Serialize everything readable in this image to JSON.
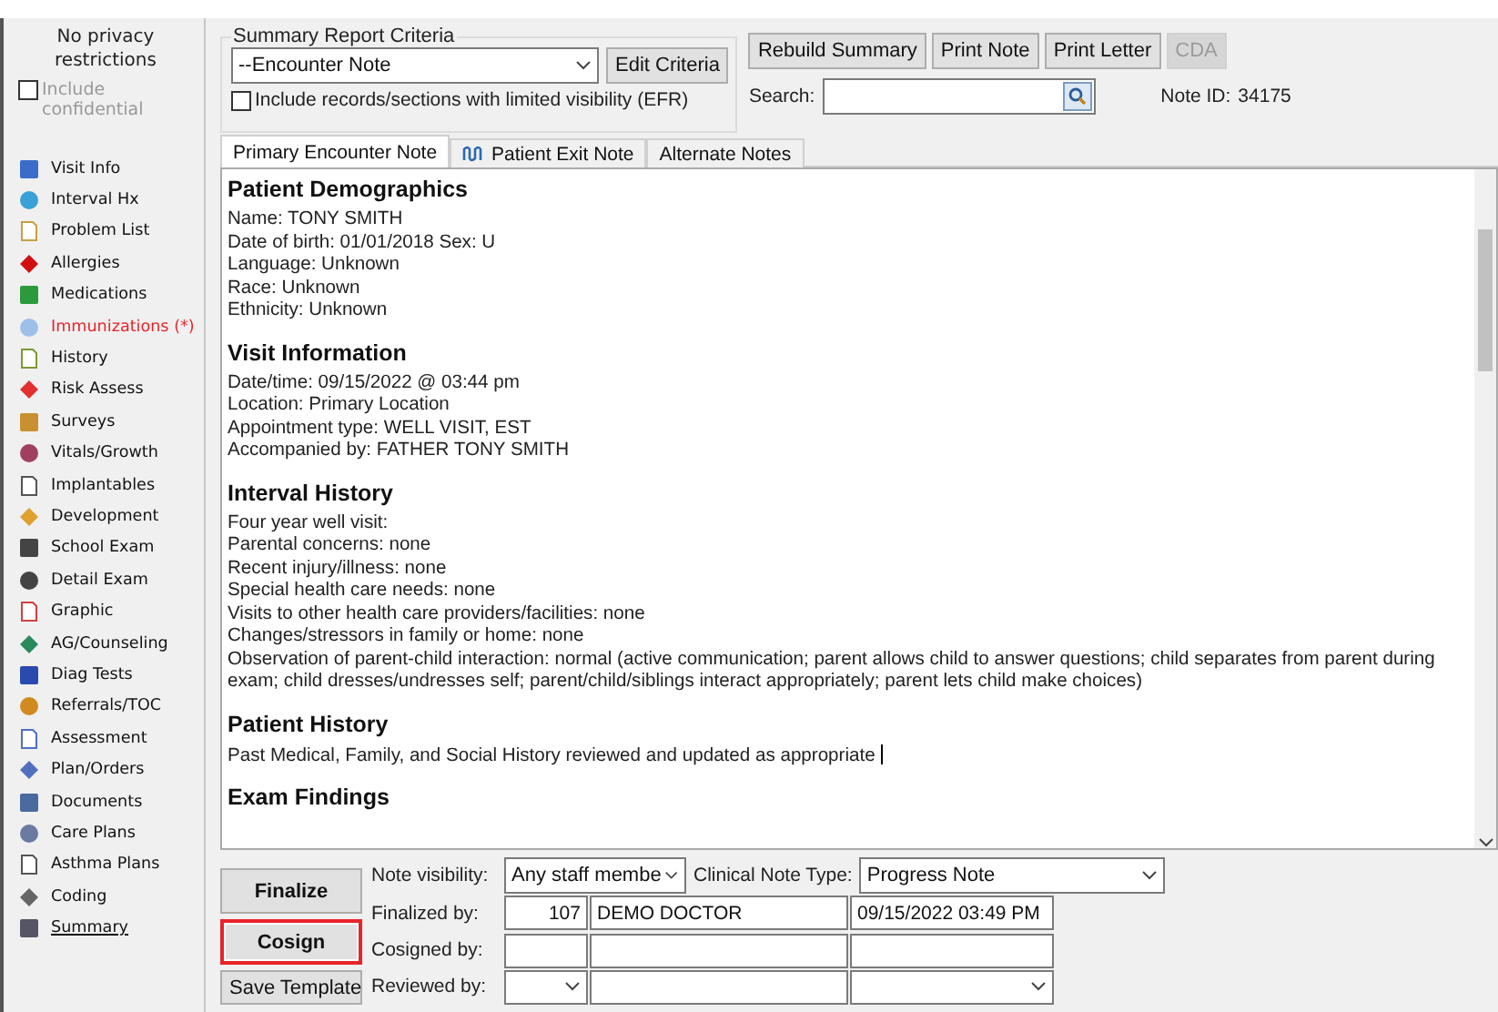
{
  "sidebar": {
    "privacy_text": "No privacy restrictions",
    "include_confidential": {
      "label": "Include confidential",
      "checked": false,
      "disabled": true
    },
    "items": [
      {
        "label": "Visit Info",
        "alert": false,
        "selected": false
      },
      {
        "label": "Interval Hx",
        "alert": false,
        "selected": false
      },
      {
        "label": "Problem List",
        "alert": false,
        "selected": false
      },
      {
        "label": "Allergies",
        "alert": false,
        "selected": false
      },
      {
        "label": "Medications",
        "alert": false,
        "selected": false
      },
      {
        "label": "Immunizations (*)",
        "alert": true,
        "selected": false
      },
      {
        "label": "History",
        "alert": false,
        "selected": false
      },
      {
        "label": "Risk Assess",
        "alert": false,
        "selected": false
      },
      {
        "label": "Surveys",
        "alert": false,
        "selected": false
      },
      {
        "label": "Vitals/Growth",
        "alert": false,
        "selected": false
      },
      {
        "label": "Implantables",
        "alert": false,
        "selected": false
      },
      {
        "label": "Development",
        "alert": false,
        "selected": false
      },
      {
        "label": "School Exam",
        "alert": false,
        "selected": false
      },
      {
        "label": "Detail Exam",
        "alert": false,
        "selected": false
      },
      {
        "label": "Graphic",
        "alert": false,
        "selected": false
      },
      {
        "label": "AG/Counseling",
        "alert": false,
        "selected": false
      },
      {
        "label": "Diag Tests",
        "alert": false,
        "selected": false
      },
      {
        "label": "Referrals/TOC",
        "alert": false,
        "selected": false
      },
      {
        "label": "Assessment",
        "alert": false,
        "selected": false
      },
      {
        "label": "Plan/Orders",
        "alert": false,
        "selected": false
      },
      {
        "label": "Documents",
        "alert": false,
        "selected": false
      },
      {
        "label": "Care Plans",
        "alert": false,
        "selected": false
      },
      {
        "label": "Asthma Plans",
        "alert": false,
        "selected": false
      },
      {
        "label": "Coding",
        "alert": false,
        "selected": false
      },
      {
        "label": "Summary",
        "alert": false,
        "selected": true
      }
    ]
  },
  "criteria": {
    "legend": "Summary Report Criteria",
    "select_value": "--Encounter Note",
    "edit_button": "Edit Criteria",
    "limited_visibility": {
      "label": "Include records/sections with limited visibility (EFR)",
      "checked": false
    }
  },
  "toolbar": {
    "buttons": [
      {
        "label": "Rebuild Summary",
        "disabled": false
      },
      {
        "label": "Print Note",
        "disabled": false
      },
      {
        "label": "Print Letter",
        "disabled": false
      },
      {
        "label": "CDA",
        "disabled": true
      }
    ],
    "search_label": "Search:",
    "note_id_label": "Note ID:",
    "note_id": "34175"
  },
  "tabs": [
    {
      "label": "Primary Encounter Note",
      "selected": true,
      "kind": "plain"
    },
    {
      "label": "Patient Exit Note",
      "selected": false,
      "kind": "icon"
    },
    {
      "label": "Alternate Notes",
      "selected": false,
      "kind": "plain"
    }
  ],
  "note": {
    "sections": [
      {
        "heading": "Patient Demographics",
        "lines": [
          "Name: TONY SMITH",
          "Date of birth: 01/01/2018   Sex: U",
          "Language: Unknown",
          "Race: Unknown",
          "Ethnicity: Unknown"
        ]
      },
      {
        "heading": "Visit Information",
        "lines": [
          "Date/time: 09/15/2022 @ 03:44 pm",
          "Location: Primary Location",
          "Appointment type: WELL VISIT, EST",
          "Accompanied by: FATHER TONY SMITH"
        ]
      },
      {
        "heading": "Interval History",
        "lines": [
          "Four year well visit:",
          "Parental concerns: none",
          "Recent injury/illness: none",
          "Special health care needs:  none",
          "Visits to other health care providers/facilities:  none",
          "Changes/stressors in family or home: none",
          "Observation of parent-child interaction: normal (active communication; parent allows child to answer questions; child separates from parent during exam; child dresses/undresses self; parent/child/siblings interact appropriately; parent lets child make choices)"
        ]
      },
      {
        "heading": "Patient History",
        "lines": [
          "Past Medical, Family, and Social History reviewed and updated as appropriate"
        ]
      },
      {
        "heading": "Exam Findings"
      }
    ]
  },
  "actions": [
    {
      "label": "Finalize",
      "highlighted": false,
      "bold": true
    },
    {
      "label": "Cosign",
      "highlighted": true,
      "bold": true
    },
    {
      "label": "Save Template",
      "highlighted": false,
      "bold": false
    }
  ],
  "signoff": {
    "note_visibility_label": "Note visibility:",
    "note_visibility": "Any staff membe",
    "clinical_note_type_label": "Clinical Note Type:",
    "clinical_note_type": "Progress Note",
    "finalized_by_label": "Finalized by:",
    "finalized_id": "107",
    "finalized_name": "DEMO DOCTOR",
    "finalized_time": "09/15/2022 03:49 PM",
    "cosigned_by_label": "Cosigned by:",
    "reviewed_by_label": "Reviewed by:"
  }
}
